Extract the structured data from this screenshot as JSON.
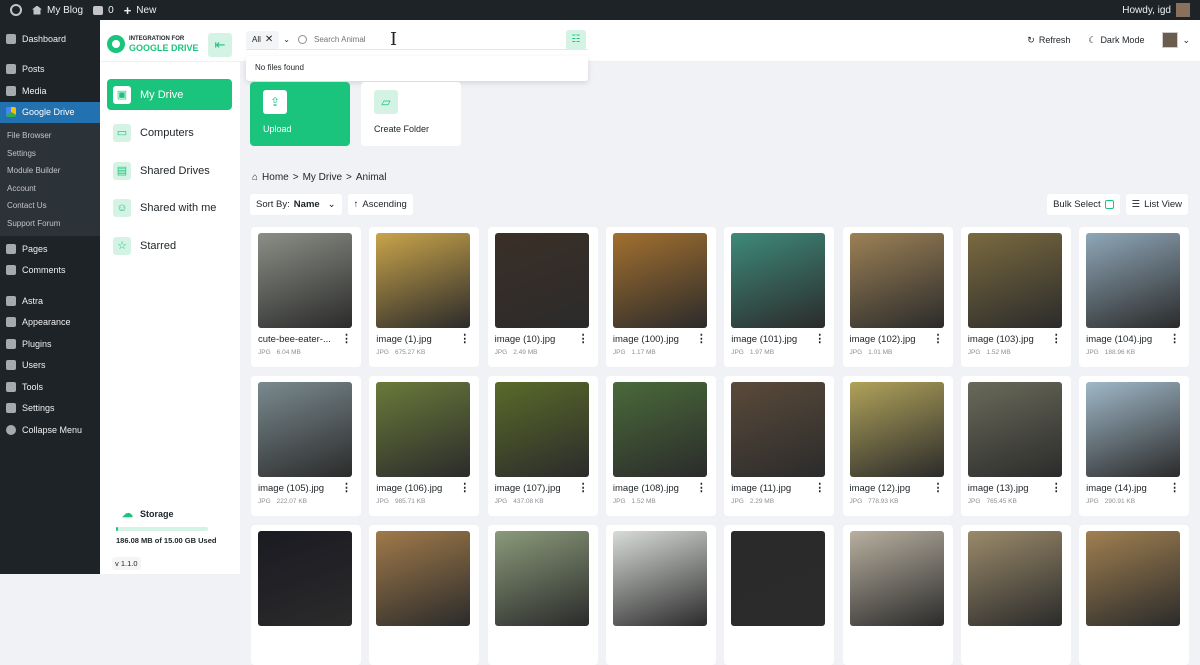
{
  "adminbar": {
    "site": "My Blog",
    "comments": "0",
    "new": "New",
    "howdy": "Howdy, igd"
  },
  "wp_menu": {
    "items_top": [
      "Dashboard"
    ],
    "items": [
      "Posts",
      "Media",
      "Google Drive"
    ],
    "submenu": [
      "File Browser",
      "Settings",
      "Module Builder",
      "Account",
      "Contact Us",
      "Support Forum"
    ],
    "items_bottom": [
      "Pages",
      "Comments"
    ],
    "items_bottom2": [
      "Astra",
      "Appearance",
      "Plugins",
      "Users",
      "Tools",
      "Settings",
      "Collapse Menu"
    ]
  },
  "logo": {
    "line1": "INTEGRATION FOR",
    "line2": "GOOGLE DRIVE"
  },
  "search": {
    "filter": "All",
    "placeholder": "Search Animal",
    "value": "",
    "no_results": "No files found"
  },
  "actions": {
    "refresh": "Refresh",
    "dark_mode": "Dark Mode"
  },
  "nav": [
    "My Drive",
    "Computers",
    "Shared Drives",
    "Shared with me",
    "Starred"
  ],
  "storage": {
    "title": "Storage",
    "used": "186.08 MB of 15.00 GB Used",
    "fraction": 0.012,
    "version": "v 1.1.0"
  },
  "tiles": {
    "upload": "Upload",
    "create_folder": "Create Folder"
  },
  "breadcrumb": [
    "Home",
    "My Drive",
    "Animal"
  ],
  "sort": {
    "label": "Sort By:",
    "value": "Name",
    "order": "Ascending",
    "bulk": "Bulk Select",
    "view": "List View"
  },
  "files": [
    {
      "name": "cute-bee-eater-...",
      "type": "JPG",
      "size": "6.04 MB",
      "color": "#8a8f86"
    },
    {
      "name": "image (1).jpg",
      "type": "JPG",
      "size": "675.27 KB",
      "color": "#c9a44a"
    },
    {
      "name": "image (10).jpg",
      "type": "JPG",
      "size": "2.49 MB",
      "color": "#3b2f27"
    },
    {
      "name": "image (100).jpg",
      "type": "JPG",
      "size": "1.17 MB",
      "color": "#a3702f"
    },
    {
      "name": "image (101).jpg",
      "type": "JPG",
      "size": "1.97 MB",
      "color": "#3e8a7a"
    },
    {
      "name": "image (102).jpg",
      "type": "JPG",
      "size": "1.01 MB",
      "color": "#9c8156"
    },
    {
      "name": "image (103).jpg",
      "type": "JPG",
      "size": "1.52 MB",
      "color": "#7a6a3f"
    },
    {
      "name": "image (104).jpg",
      "type": "JPG",
      "size": "188.96 KB",
      "color": "#8fa7b8"
    },
    {
      "name": "image (105).jpg",
      "type": "JPG",
      "size": "222.07 KB",
      "color": "#7a8a8f"
    },
    {
      "name": "image (106).jpg",
      "type": "JPG",
      "size": "985.71 KB",
      "color": "#6a7a3a"
    },
    {
      "name": "image (107).jpg",
      "type": "JPG",
      "size": "437.08 KB",
      "color": "#5a6a2a"
    },
    {
      "name": "image (108).jpg",
      "type": "JPG",
      "size": "1.52 MB",
      "color": "#4a6a3a"
    },
    {
      "name": "image (11).jpg",
      "type": "JPG",
      "size": "2.29 MB",
      "color": "#5a4a3a"
    },
    {
      "name": "image (12).jpg",
      "type": "JPG",
      "size": "778.93 KB",
      "color": "#b0a25a"
    },
    {
      "name": "image (13).jpg",
      "type": "JPG",
      "size": "765.45 KB",
      "color": "#6a6a5a"
    },
    {
      "name": "image (14).jpg",
      "type": "JPG",
      "size": "290.91 KB",
      "color": "#a0b8c8"
    },
    {
      "name": "",
      "type": "",
      "size": "",
      "color": "#1a1a22"
    },
    {
      "name": "",
      "type": "",
      "size": "",
      "color": "#a07a4a"
    },
    {
      "name": "",
      "type": "",
      "size": "",
      "color": "#8a9a7a"
    },
    {
      "name": "",
      "type": "",
      "size": "",
      "color": "#d8dcd8"
    },
    {
      "name": "",
      "type": "",
      "size": "",
      "color": "#2a2a2a"
    },
    {
      "name": "",
      "type": "",
      "size": "",
      "color": "#b8b0a0"
    },
    {
      "name": "",
      "type": "",
      "size": "",
      "color": "#9a8a6a"
    },
    {
      "name": "",
      "type": "",
      "size": "",
      "color": "#a08050"
    }
  ]
}
